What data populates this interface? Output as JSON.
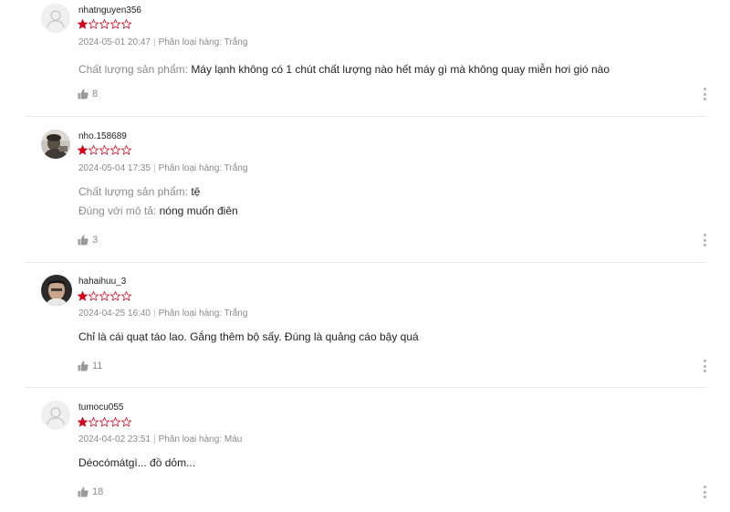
{
  "colors": {
    "star": "#d0011b",
    "muted": "#8a8a8a",
    "divider": "#e8e8e8"
  },
  "reviews": [
    {
      "username": "nhatnguyen356",
      "rating": 1,
      "max_rating": 5,
      "date": "2024-05-01 20:47",
      "variation": "Phân loại hàng: Trắng",
      "attributes": [
        {
          "label": "Chất lượng sản phẩm:",
          "value": "Máy lạnh không có 1 chút chất lượng nào hết máy gì mà không quay miễn hơi gió nào"
        }
      ],
      "comment": "",
      "likes": "8",
      "avatar": "placeholder"
    },
    {
      "username": "nho.158689",
      "rating": 1,
      "max_rating": 5,
      "date": "2024-05-04 17:35",
      "variation": "Phân loại hàng: Trắng",
      "attributes": [
        {
          "label": "Chất lượng sản phẩm:",
          "value": "tệ"
        },
        {
          "label": "Đúng với mô tả:",
          "value": "nóng muốn điên"
        }
      ],
      "comment": "",
      "likes": "3",
      "avatar": "photo"
    },
    {
      "username": "hahaihuu_3",
      "rating": 1,
      "max_rating": 5,
      "date": "2024-04-25 16:40",
      "variation": "Phân loại hàng: Trắng",
      "attributes": [],
      "comment": "Chỉ là cái quạt táo lao. Gắng thêm bộ sấy. Đúng là quảng cáo bậy quá",
      "likes": "11",
      "avatar": "photo"
    },
    {
      "username": "tumocu055",
      "rating": 1,
      "max_rating": 5,
      "date": "2024-04-02 23:51",
      "variation": "Phân loại hàng: Màu",
      "attributes": [],
      "comment": "Déocómátgì... đồ dỏm...",
      "likes": "18",
      "avatar": "placeholder"
    }
  ]
}
